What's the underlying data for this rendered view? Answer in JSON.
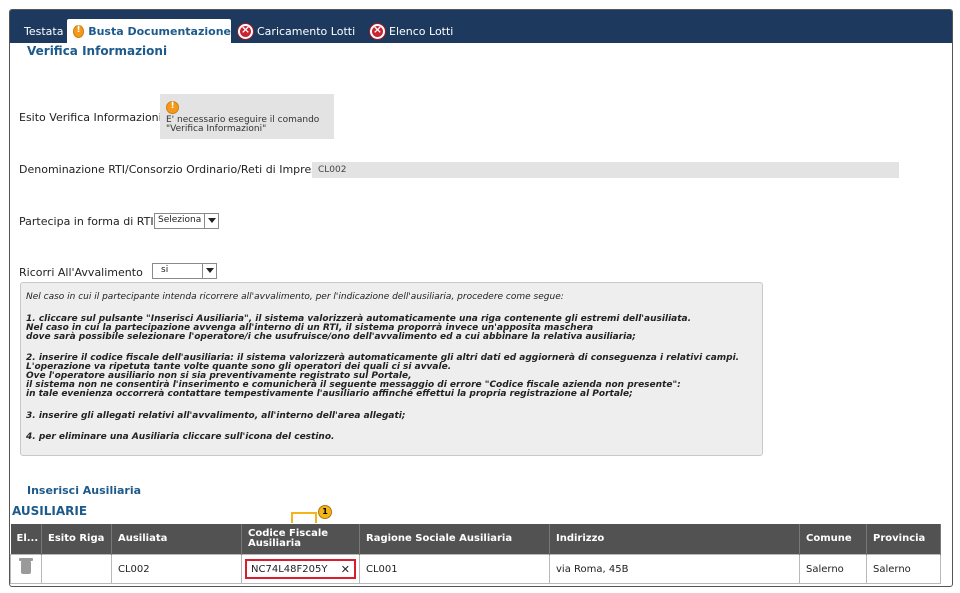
{
  "tabs": [
    {
      "label": "Testata",
      "icon": ""
    },
    {
      "label": "Busta Documentazione",
      "icon": "warning-icon"
    },
    {
      "label": "Caricamento Lotti",
      "icon": "error-icon"
    },
    {
      "label": "Elenco Lotti",
      "icon": "error-icon"
    }
  ],
  "section": {
    "title": "Verifica Informazioni"
  },
  "esito": {
    "label": "Esito Verifica Informazioni",
    "message_line1": "E' necessario eseguire il comando",
    "message_line2": "\"Verifica Informazioni\""
  },
  "denominazione": {
    "label": "Denominazione RTI/Consorzio Ordinario/Reti di Impresa",
    "value": "CL002"
  },
  "partecipa": {
    "label": "Partecipa in forma di RTI",
    "selected": "Seleziona"
  },
  "ricorri": {
    "label": "Ricorri All'Avvalimento",
    "selected": "si"
  },
  "instructions": [
    "Nel caso in cui il partecipante intenda ricorrere all'avvalimento, per l'indicazione dell'ausiliaria, procedere come segue:",
    "1. cliccare sul pulsante \"Inserisci Ausiliaria\", il sistema valorizzerà automaticamente una riga contenente gli estremi dell'ausiliata.",
    "Nel caso in cui la partecipazione avvenga all'interno di un RTI, il sistema proporrà invece un'apposita maschera",
    "dove sarà possibile selezionare l'operatore/i che usufruisce/ono dell'avvalimento ed a cui abbinare la relativa ausiliaria;",
    "2. inserire il codice fiscale dell'ausiliaria: il sistema valorizzerà automaticamente gli altri dati ed aggiornerà di conseguenza i relativi campi.",
    "L'operazione va ripetuta tante volte quante sono gli operatori dei quali ci si avvale.",
    "Ove l'operatore ausiliario non si sia preventivamente registrato sul Portale,",
    "il sistema non ne consentirà l'inserimento e comunicherà il seguente messaggio di errore \"Codice fiscale azienda non presente\":",
    "in tale evenienza occorrerà contattare tempestivamente l'ausiliario affinché effettui la propria registrazione al Portale;",
    "3. inserire gli allegati relativi all'avvalimento, all'interno dell'area allegati;",
    "4. per eliminare una Ausiliaria cliccare sull'icona del cestino."
  ],
  "insert_link": "Inserisci Ausiliaria",
  "grid_title": "AUSILIARIE",
  "columns": [
    "El...",
    "Esito Riga",
    "Ausiliata",
    "Codice Fiscale Ausiliaria",
    "Ragione Sociale Ausiliaria",
    "Indirizzo",
    "Comune",
    "Provincia"
  ],
  "row": {
    "esito": "",
    "ausiliata": "CL002",
    "codice_fiscale": "NC74L48F205Y",
    "ragione_sociale": "CL001",
    "indirizzo": "via Roma, 45B",
    "comune": "Salerno",
    "provincia": "Salerno"
  },
  "callout_number": "1",
  "colors": {
    "header": "#1d3a5e",
    "accent": "#1d5a8c",
    "highlight": "#d81e2e",
    "callout": "#f4b51b"
  }
}
